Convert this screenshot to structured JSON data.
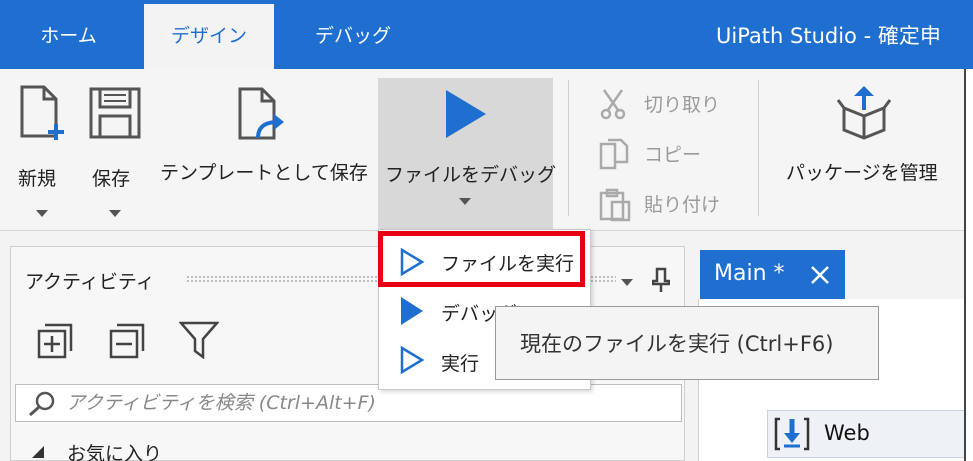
{
  "tabs": [
    {
      "label": "ホーム",
      "active": false
    },
    {
      "label": "デザイン",
      "active": true
    },
    {
      "label": "デバッグ",
      "active": false
    }
  ],
  "app_title": "UiPath Studio - 確定申",
  "ribbon": {
    "new_label": "新規",
    "save_label": "保存",
    "save_template_label": "テンプレートとして保存",
    "debug_file_label": "ファイルをデバッグ",
    "cut_label": "切り取り",
    "copy_label": "コピー",
    "paste_label": "貼り付け",
    "manage_packages_label": "パッケージを管理"
  },
  "dropdown": {
    "items": [
      {
        "label": "ファイルを実行",
        "icon": "play-outline-icon"
      },
      {
        "label": "デバッグ",
        "icon": "play-filled-icon"
      },
      {
        "label": "実行",
        "icon": "play-outline-icon"
      }
    ]
  },
  "tooltip": {
    "text": "現在のファイルを実行 (Ctrl+F6)"
  },
  "activities": {
    "title": "アクティビティ",
    "search_placeholder": "アクティビティを検索 (Ctrl+Alt+F)",
    "favorites_label": "お気に入り"
  },
  "designer": {
    "tab_label": "Main *",
    "web_activity_label": "Web"
  },
  "colors": {
    "accent": "#1e6fd0",
    "highlight": "#e60012"
  }
}
